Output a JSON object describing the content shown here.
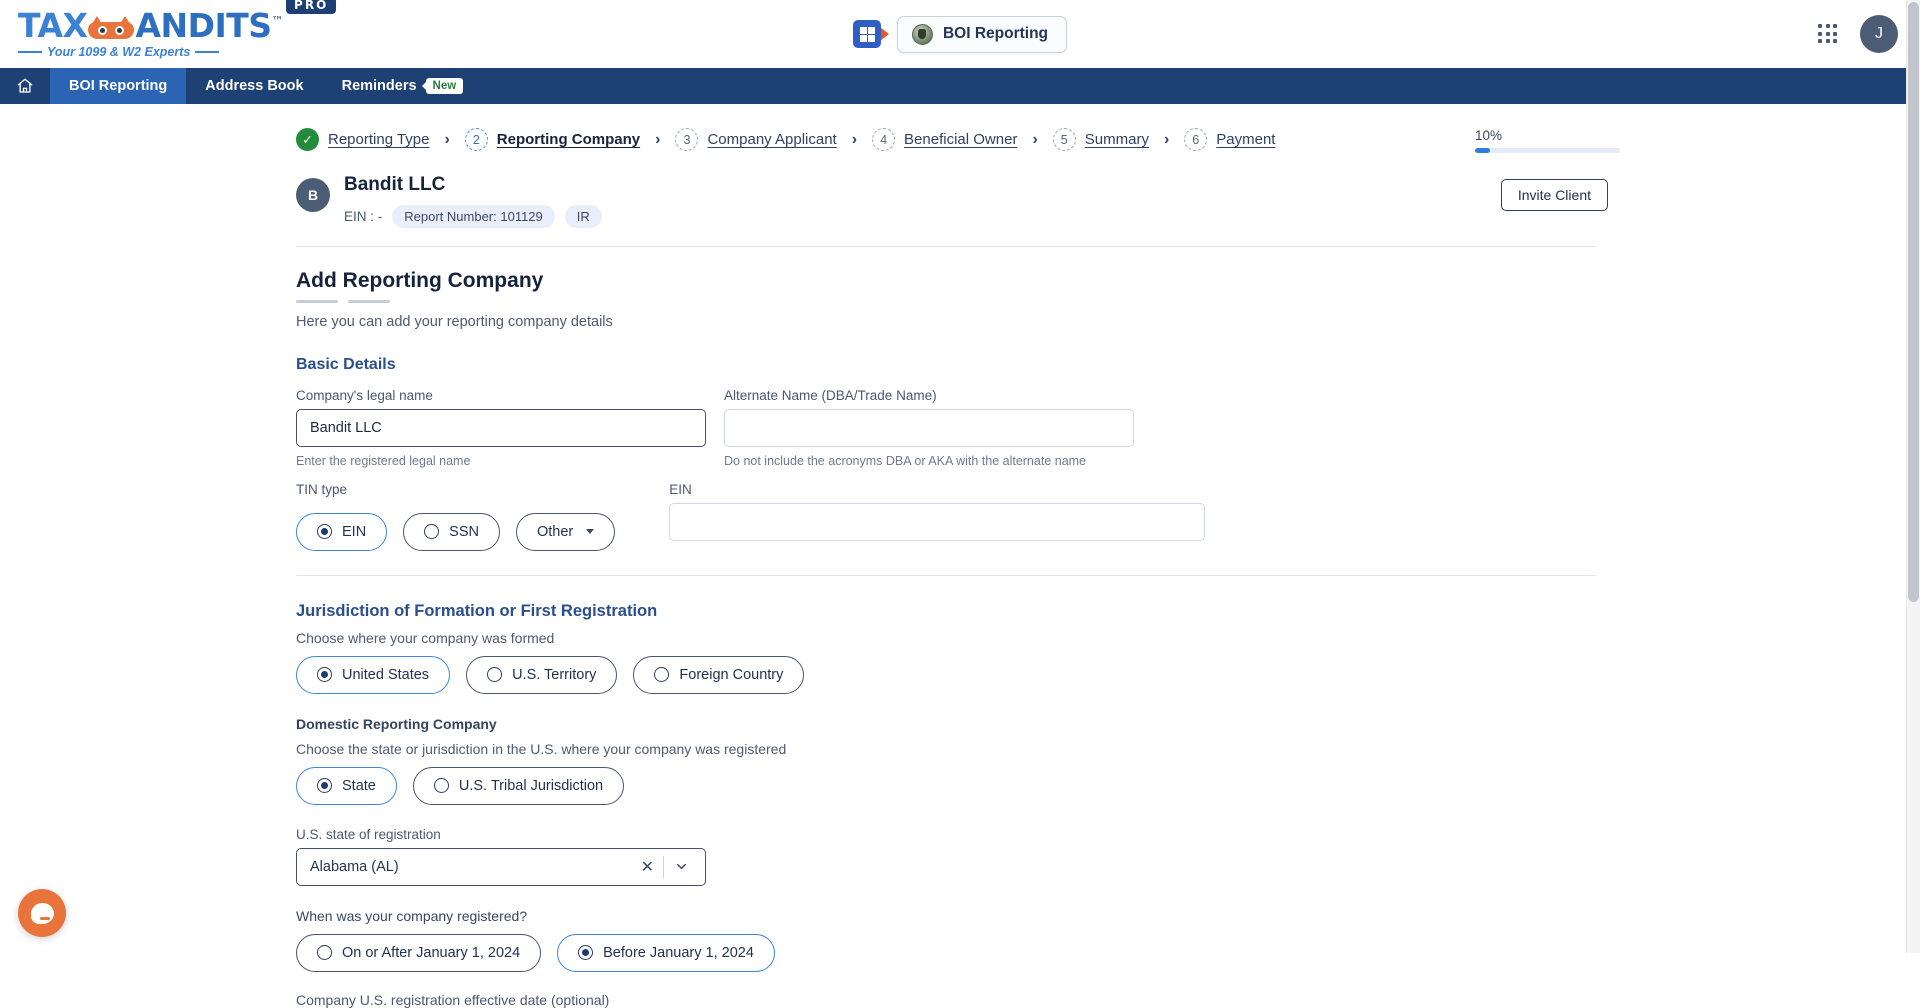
{
  "brand": {
    "logo_text_1": "TAX",
    "logo_text_2": "ANDITS",
    "trademark": "™",
    "pro_badge": "PRO",
    "tagline": "Your 1099 & W2 Experts"
  },
  "topbar": {
    "product_button": "BOI Reporting",
    "apps_icon": "apps-grid-icon",
    "avatar_initial": "J"
  },
  "nav": {
    "home_icon": "home-icon",
    "items": [
      {
        "label": "BOI Reporting",
        "active": true
      },
      {
        "label": "Address Book",
        "active": false
      },
      {
        "label": "Reminders",
        "active": false,
        "badge": "New"
      }
    ]
  },
  "stepper": {
    "steps": [
      {
        "num": "✓",
        "label": "Reporting Type",
        "state": "done"
      },
      {
        "num": "2",
        "label": "Reporting Company",
        "state": "current"
      },
      {
        "num": "3",
        "label": "Company Applicant",
        "state": "todo"
      },
      {
        "num": "4",
        "label": "Beneficial Owner",
        "state": "todo"
      },
      {
        "num": "5",
        "label": "Summary",
        "state": "todo"
      },
      {
        "num": "6",
        "label": "Payment",
        "state": "todo"
      }
    ],
    "separator": "›",
    "progress_percent": "10%",
    "progress_value": 10
  },
  "company": {
    "avatar_initial": "B",
    "name": "Bandit LLC",
    "ein_label": "EIN : -",
    "report_number": "Report Number: 101129",
    "ir_chip": "IR",
    "invite_button": "Invite Client"
  },
  "main": {
    "title": "Add Reporting Company",
    "subtitle": "Here you can add your reporting company details",
    "basic_details_heading": "Basic Details",
    "legal_name": {
      "label": "Company's legal name",
      "value": "Bandit LLC",
      "hint": "Enter the registered legal name"
    },
    "alternate_name": {
      "label": "Alternate Name (DBA/Trade Name)",
      "value": "",
      "placeholder": "",
      "hint": "Do not include the acronyms DBA or AKA with the alternate name"
    },
    "tin": {
      "label": "TIN type",
      "options": [
        {
          "label": "EIN",
          "selected": true
        },
        {
          "label": "SSN",
          "selected": false
        }
      ],
      "other_label": "Other"
    },
    "ein": {
      "label": "EIN",
      "value": "",
      "placeholder": ""
    },
    "jurisdiction": {
      "heading": "Jurisdiction of Formation or First Registration",
      "helper": "Choose where your company was formed",
      "options": [
        {
          "label": "United States",
          "selected": true
        },
        {
          "label": "U.S. Territory",
          "selected": false
        },
        {
          "label": "Foreign Country",
          "selected": false
        }
      ]
    },
    "domestic": {
      "subhead": "Domestic Reporting Company",
      "helper": "Choose the state or jurisdiction in the U.S. where your company was registered",
      "options": [
        {
          "label": "State",
          "selected": true
        },
        {
          "label": "U.S. Tribal Jurisdiction",
          "selected": false
        }
      ]
    },
    "state_select": {
      "label": "U.S. state of registration",
      "value": "Alabama (AL)",
      "clear_icon": "clear-x-icon",
      "chevron_icon": "chevron-down-icon"
    },
    "registered_when": {
      "question": "When was your company registered?",
      "options": [
        {
          "label": "On or After January 1, 2024",
          "selected": false
        },
        {
          "label": "Before January 1, 2024",
          "selected": true
        }
      ]
    },
    "effective_date_label": "Company U.S. registration effective date (optional)"
  },
  "chat": {
    "icon": "chat-bubble-icon"
  },
  "colors": {
    "nav_bg": "#1d4075",
    "nav_active": "#2c64b4",
    "accent_blue": "#2f7de1",
    "brand_blue": "#3b82d6",
    "brand_orange": "#e8743b",
    "success_green": "#228b3c"
  }
}
